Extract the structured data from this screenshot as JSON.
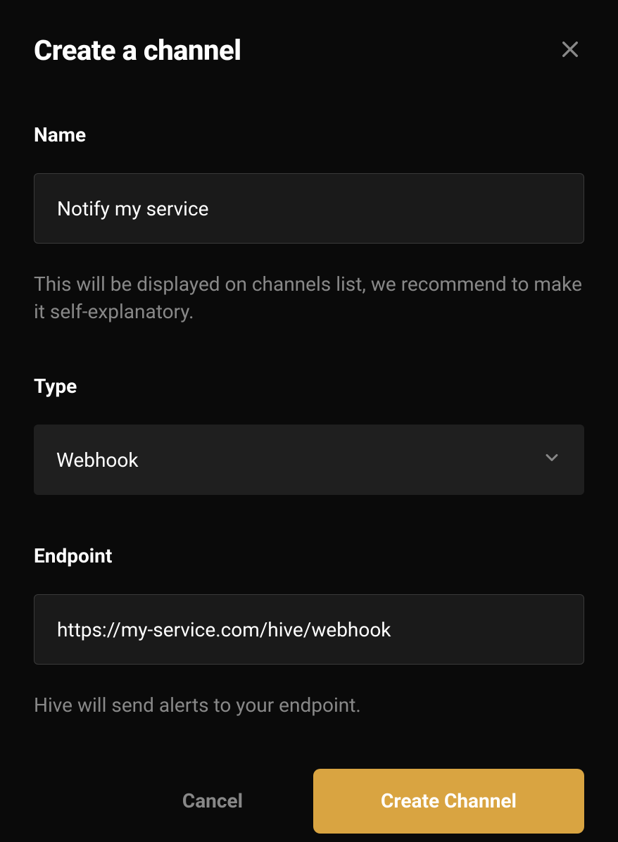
{
  "modal": {
    "title": "Create a channel"
  },
  "fields": {
    "name": {
      "label": "Name",
      "value": "Notify my service",
      "help": "This will be displayed on channels list, we recommend to make it self-explanatory."
    },
    "type": {
      "label": "Type",
      "selected": "Webhook"
    },
    "endpoint": {
      "label": "Endpoint",
      "value": "https://my-service.com/hive/webhook",
      "help": "Hive will send alerts to your endpoint."
    }
  },
  "actions": {
    "cancel": "Cancel",
    "create": "Create Channel"
  }
}
